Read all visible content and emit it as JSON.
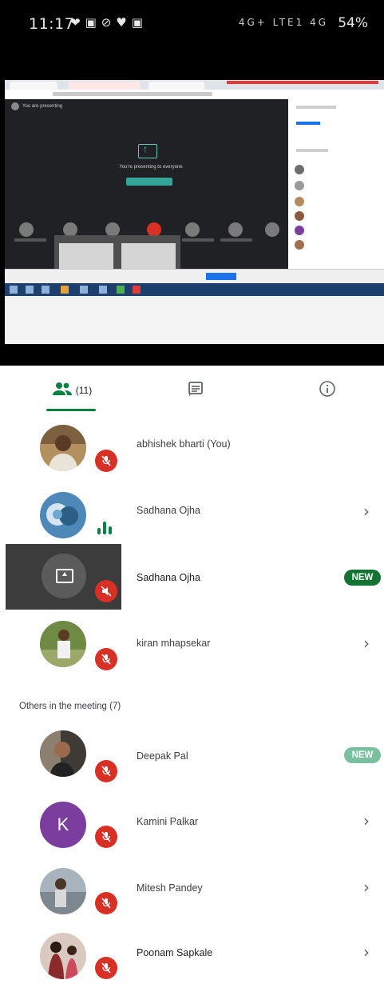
{
  "status_bar": {
    "time": "11:17",
    "left_icons": [
      "heart-icon",
      "gallery-icon",
      "wifi-off-icon",
      "location-icon",
      "photo-icon"
    ],
    "network_text": "4G+ LTE1 4G",
    "battery": "54%"
  },
  "tabs": {
    "people_count": "(11)",
    "people_icon": "people-icon",
    "chat_icon": "chat-icon",
    "info_icon": "info-icon",
    "accent_color": "#0b8043"
  },
  "participants": [
    {
      "name": "abhishek bharti (You)",
      "muted": true,
      "chevron": ""
    },
    {
      "name": "Sadhana Ojha",
      "muted": false,
      "speaking": true,
      "chevron": "›"
    },
    {
      "name": "Sadhana Ojha",
      "presenting": true,
      "badge": "NEW"
    },
    {
      "name": "kiran mhapsekar",
      "muted": true,
      "chevron": "›"
    }
  ],
  "others_label": "Others in the meeting (7)",
  "others": [
    {
      "name": "Deepak Pal",
      "muted": true,
      "badge": "NEW"
    },
    {
      "name": "Kamini Palkar",
      "muted": true,
      "initial": "K",
      "chevron": "›"
    },
    {
      "name": "Mitesh Pandey",
      "muted": true,
      "chevron": "›"
    },
    {
      "name": "Poonam Sapkale",
      "muted": true,
      "chevron": "›"
    }
  ],
  "colors": {
    "muted_red": "#d93025",
    "new_badge": "#137333",
    "kamini_avatar": "#7c3e9e"
  }
}
